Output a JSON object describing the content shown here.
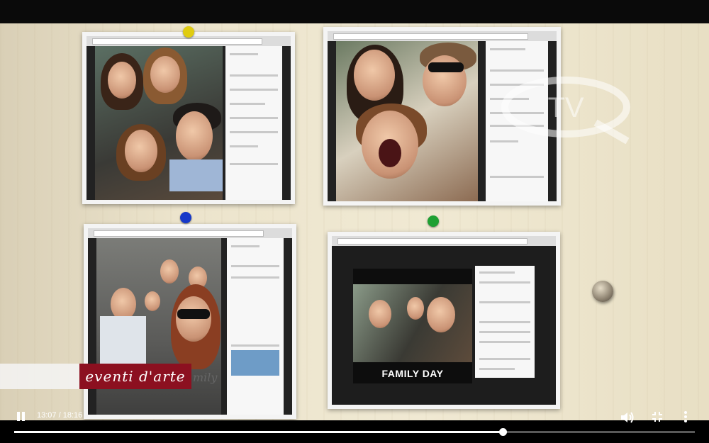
{
  "overlay": {
    "banner_text": "eventi d'arte",
    "banner_color": "#8c1020",
    "partial_text": "mily"
  },
  "photos": [
    {
      "id": "photo-1",
      "caption": ""
    },
    {
      "id": "photo-2",
      "caption": ""
    },
    {
      "id": "photo-3",
      "caption": ""
    },
    {
      "id": "photo-4",
      "caption": "FAMILY DAY"
    }
  ],
  "watermark": {
    "text": "TV"
  },
  "player": {
    "current_time": "13:07",
    "separator": "/",
    "duration": "18:16",
    "progress": 0.718,
    "icons": {
      "play_pause": "pause-icon",
      "volume": "volume-icon",
      "fullscreen": "exit-fullscreen-icon",
      "more": "more-vert-icon"
    }
  }
}
